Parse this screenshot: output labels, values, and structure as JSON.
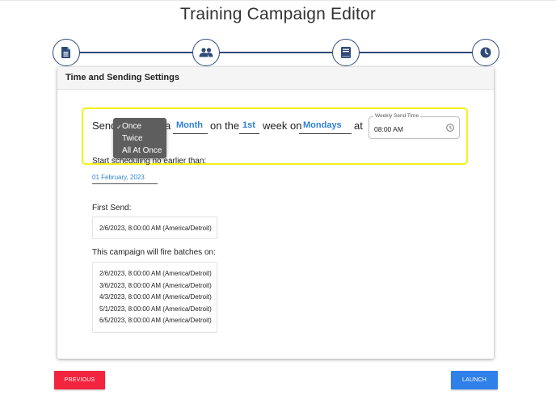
{
  "header": {
    "title": "Training Campaign Editor"
  },
  "stepper": {
    "steps": [
      {
        "icon": "document-icon"
      },
      {
        "icon": "users-icon"
      },
      {
        "icon": "book-icon"
      },
      {
        "icon": "clock-icon"
      }
    ],
    "accent_color": "#2f4a78"
  },
  "card": {
    "header": "Time and Sending Settings",
    "sentence": {
      "send": "Send",
      "a": "a",
      "on_the": "on the",
      "week_on": "week on",
      "at": "at",
      "period_value": "Month",
      "week_value": "1st",
      "day_value": "Mondays"
    },
    "frequency_dropdown": {
      "options": [
        "Once",
        "Twice",
        "All At Once"
      ],
      "selected": "Once",
      "check": "✓"
    },
    "weekly_send_time": {
      "label": "Weekly Send Time",
      "value": "08:00 AM"
    },
    "start_scheduling": {
      "label": "Start scheduling no earlier than:",
      "value": "01 February, 2023"
    },
    "first_send": {
      "label": "First Send:",
      "value": "2/6/2023, 8:00:00 AM (America/Detroit)"
    },
    "batches": {
      "label": "This campaign will fire batches on:",
      "dates": [
        "2/6/2023, 8:00:00 AM (America/Detroit)",
        "3/6/2023, 8:00:00 AM (America/Detroit)",
        "4/3/2023, 8:00:00 AM (America/Detroit)",
        "5/1/2023, 8:00:00 AM (America/Detroit)",
        "6/5/2023, 8:00:00 AM (America/Detroit)"
      ]
    }
  },
  "footer": {
    "previous_label": "PREVIOUS",
    "launch_label": "LAUNCH",
    "previous_color": "#f2243e",
    "launch_color": "#2f80e8"
  }
}
